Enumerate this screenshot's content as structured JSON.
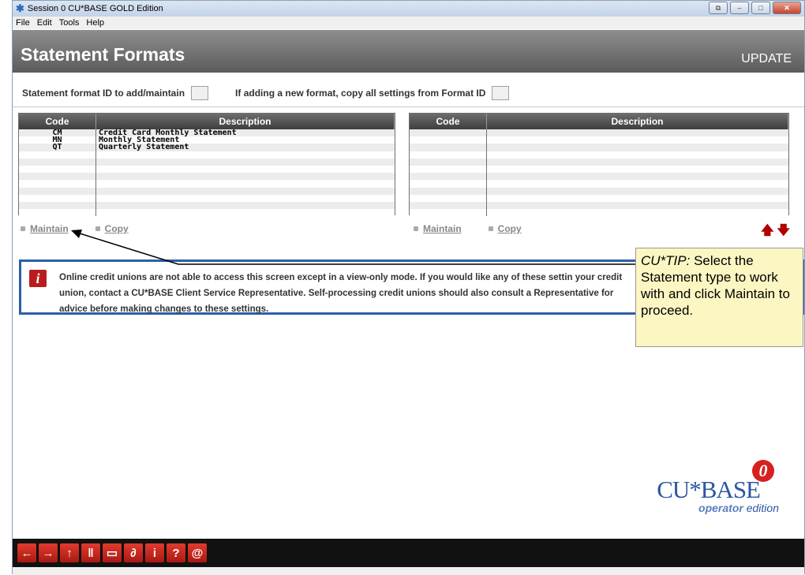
{
  "window": {
    "title": "Session 0 CU*BASE GOLD Edition"
  },
  "menu": [
    "File",
    "Edit",
    "Tools",
    "Help"
  ],
  "header": {
    "title": "Statement Formats",
    "mode": "UPDATE"
  },
  "id_row": {
    "format_label": "Statement format ID to add/maintain",
    "copy_label": "If adding a new format, copy all settings from Format ID"
  },
  "left_grid": {
    "columns": [
      "Code",
      "Description"
    ],
    "rows": [
      {
        "code": "CM",
        "description": "Credit Card Monthly Statement"
      },
      {
        "code": "MN",
        "description": "Monthly Statement"
      },
      {
        "code": "QT",
        "description": "Quarterly Statement"
      }
    ]
  },
  "right_grid": {
    "columns": [
      "Code",
      "Description"
    ]
  },
  "actions_left": {
    "maintain": "Maintain",
    "copy": "Copy"
  },
  "actions_right": {
    "maintain": "Maintain",
    "copy": "Copy"
  },
  "info": {
    "text": "Online credit unions are not able to access this screen except in a view-only mode. If you would like any of these settin your credit union, contact a CU*BASE Client Service Representative. Self-processing credit unions should also consult a Representative for advice before making changes to these settings."
  },
  "tip": {
    "prefix": "CU*TIP:",
    "text": "Select the Statement type to work with and click Maintain to proceed."
  },
  "logo": {
    "brand": "CU*BASE",
    "badge": "0",
    "edition_a": "operator",
    "edition_b": "edition"
  },
  "toolbar": [
    "back-icon",
    "forward-icon",
    "up-icon",
    "pause-icon",
    "print-icon",
    "link-icon",
    "info-icon",
    "help-icon",
    "at-icon"
  ],
  "colors": {
    "accent": "#2a60a8",
    "alert": "#b81d1d",
    "tip_bg": "#fcf6c2"
  }
}
